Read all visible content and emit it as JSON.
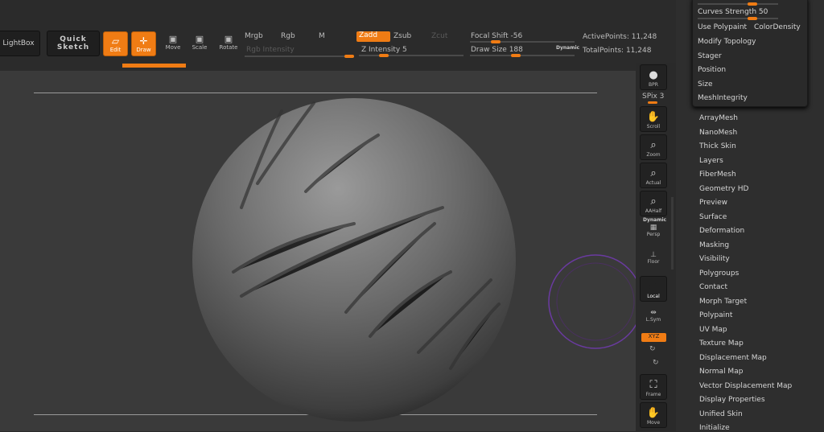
{
  "toolbar": {
    "lightbox": "LightBox",
    "quick_sketch": "Quick Sketch",
    "edit": "Edit",
    "draw": "Draw",
    "move": "Move",
    "scale": "Scale",
    "rotate": "Rotate",
    "mrgb": "Mrgb",
    "rgb": "Rgb",
    "m": "M",
    "rgb_intensity": "Rgb Intensity",
    "zadd": "Zadd",
    "zsub": "Zsub",
    "zcut": "Zcut",
    "z_intensity": "Z Intensity 5",
    "z_intensity_value": 5,
    "focal_shift": "Focal Shift -56",
    "focal_shift_value": -56,
    "draw_size": "Draw Size 188",
    "draw_size_value": 188,
    "dynamic": "Dynamic",
    "active_points": "ActivePoints: 11,248",
    "total_points": "TotalPoints: 11,248"
  },
  "right_shelf": {
    "bpr": "BPR",
    "spix": "SPix 3",
    "scroll": "Scroll",
    "zoom": "Zoom",
    "actual": "Actual",
    "aahalf": "AAHalf",
    "dynamic": "Dynamic",
    "persp": "Persp",
    "floor": "Floor",
    "local": "Local",
    "lsym": "L.Sym",
    "xyz": "XYZ",
    "frame": "Frame",
    "move": "Move"
  },
  "popup": {
    "curves_strength": "Curves Strength 50",
    "curves_strength_value": 50,
    "use_polypaint": "Use Polypaint",
    "color_density": "ColorDensity",
    "items": [
      "Modify Topology",
      "Stager",
      "Position",
      "Size",
      "MeshIntegrity"
    ]
  },
  "tool_menu": [
    "ArrayMesh",
    "NanoMesh",
    "Thick Skin",
    "Layers",
    "FiberMesh",
    "Geometry HD",
    "Preview",
    "Surface",
    "Deformation",
    "Masking",
    "Visibility",
    "Polygroups",
    "Contact",
    "Morph Target",
    "Polypaint",
    "UV Map",
    "Texture Map",
    "Displacement Map",
    "Normal Map",
    "Vector Displacement Map",
    "Display Properties",
    "Unified Skin",
    "Initialize"
  ],
  "colors": {
    "accent": "#f07c14",
    "brush_ring": "#6a3aa0"
  }
}
